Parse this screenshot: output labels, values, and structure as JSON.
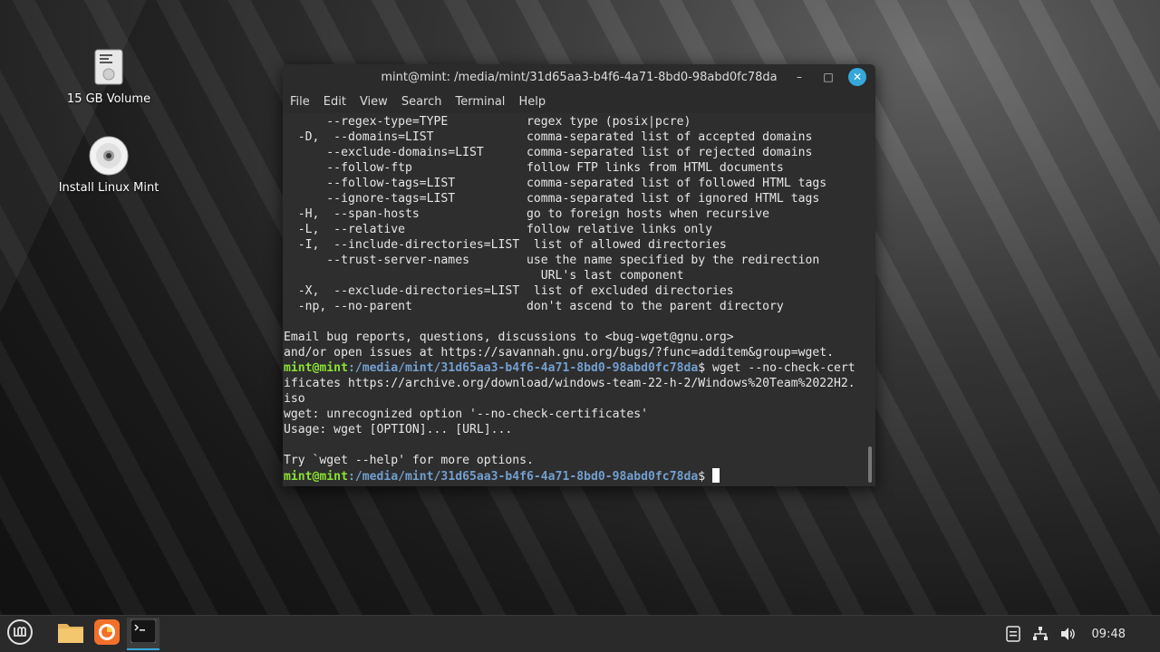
{
  "desktop": {
    "icons": [
      {
        "label": "15 GB Volume",
        "icon": "drive-icon"
      },
      {
        "label": "Install Linux Mint",
        "icon": "disc-icon"
      }
    ]
  },
  "window": {
    "title": "mint@mint: /media/mint/31d65aa3-b4f6-4a71-8bd0-98abd0fc78da",
    "minimize": "–",
    "maximize": "□",
    "close": "✕",
    "menu": [
      "File",
      "Edit",
      "View",
      "Search",
      "Terminal",
      "Help"
    ]
  },
  "terminal": {
    "lines": [
      "      --regex-type=TYPE           regex type (posix|pcre)",
      "  -D,  --domains=LIST             comma-separated list of accepted domains",
      "      --exclude-domains=LIST      comma-separated list of rejected domains",
      "      --follow-ftp                follow FTP links from HTML documents",
      "      --follow-tags=LIST          comma-separated list of followed HTML tags",
      "      --ignore-tags=LIST          comma-separated list of ignored HTML tags",
      "  -H,  --span-hosts               go to foreign hosts when recursive",
      "  -L,  --relative                 follow relative links only",
      "  -I,  --include-directories=LIST  list of allowed directories",
      "      --trust-server-names        use the name specified by the redirection",
      "                                    URL's last component",
      "  -X,  --exclude-directories=LIST  list of excluded directories",
      "  -np, --no-parent                don't ascend to the parent directory",
      "",
      "Email bug reports, questions, discussions to <bug-wget@gnu.org>",
      "and/or open issues at https://savannah.gnu.org/bugs/?func=additem&group=wget."
    ],
    "prompt_user": "mint@mint",
    "prompt_path": ":/media/mint/31d65aa3-b4f6-4a71-8bd0-98abd0fc78da",
    "prompt_symbol": "$ ",
    "command_part1": "wget --no-check-cert",
    "command_part2": "ificates https://archive.org/download/windows-team-22-h-2/Windows%20Team%2022H2.",
    "command_part3": "iso",
    "output": [
      "wget: unrecognized option '--no-check-certificates'",
      "Usage: wget [OPTION]... [URL]...",
      "",
      "Try `wget --help' for more options."
    ]
  },
  "taskbar": {
    "menu_icon": "mint-menu-icon",
    "apps": [
      "files-icon",
      "firefox-icon",
      "terminal-icon"
    ],
    "clock": "09:48"
  }
}
